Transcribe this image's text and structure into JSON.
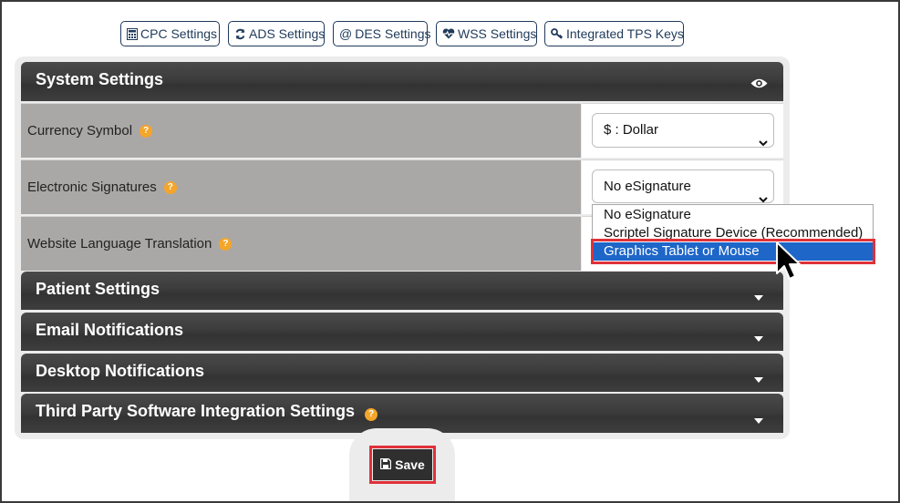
{
  "tabs": [
    {
      "label": "CPC Settings",
      "icon": "calculator-icon"
    },
    {
      "label": "ADS Settings",
      "icon": "sync-icon"
    },
    {
      "label": "DES Settings",
      "icon": "at-icon"
    },
    {
      "label": "WSS Settings",
      "icon": "heartbeat-icon"
    },
    {
      "label": "Integrated TPS Keys",
      "icon": "key-icon"
    }
  ],
  "sections": {
    "system": {
      "title": "System Settings",
      "icon": "eye-icon"
    },
    "patient": {
      "title": "Patient Settings"
    },
    "email": {
      "title": "Email Notifications"
    },
    "desktop": {
      "title": "Desktop Notifications"
    },
    "third_party": {
      "title": "Third Party Software Integration Settings"
    }
  },
  "settings": [
    {
      "label": "Currency Symbol",
      "value": "$ : Dollar"
    },
    {
      "label": "Electronic Signatures",
      "value": "No eSignature"
    },
    {
      "label": "Website Language Translation",
      "value": ""
    }
  ],
  "esignature_options": [
    "No eSignature",
    "Scriptel Signature Device (Recommended)",
    "Graphics Tablet or Mouse"
  ],
  "highlighted_option": "Graphics Tablet or Mouse",
  "help_glyph": "?",
  "save_label": "Save",
  "colors": {
    "header_bar": "#3c3c3c",
    "label_bg": "#aaa8a7",
    "accent_blue": "#1e66c8",
    "highlight_red": "#e03139",
    "help_orange": "#f4a52a"
  }
}
